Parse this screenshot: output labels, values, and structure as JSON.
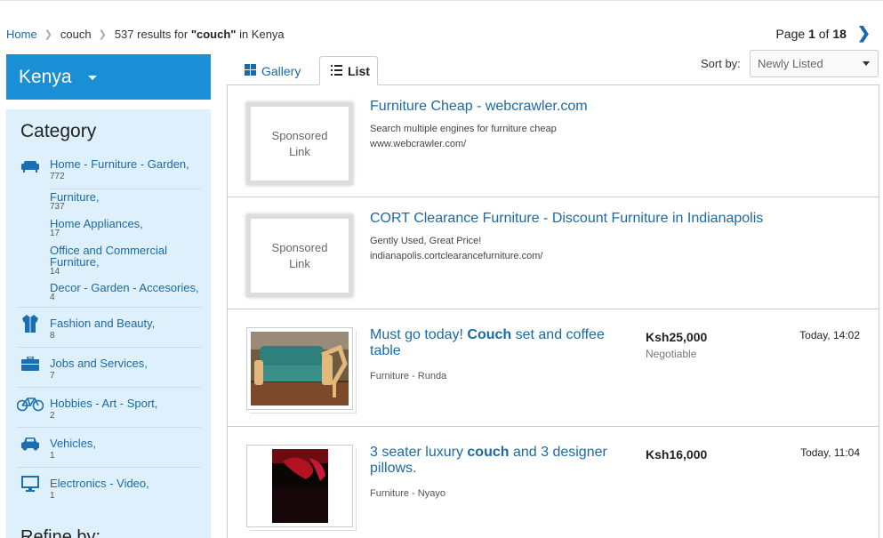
{
  "breadcrumb": {
    "home": "Home",
    "query": "couch",
    "results_prefix": "537 results for ",
    "results_query": "\"couch\"",
    "results_suffix": " in Kenya"
  },
  "pager": {
    "prefix": "Page ",
    "current": "1",
    "of": " of ",
    "total": "18"
  },
  "country": "Kenya",
  "sidebar": {
    "heading": "Category",
    "refine": "Refine by:",
    "categories": [
      {
        "label": "Home - Furniture - Garden,",
        "count": "772",
        "icon": "sofa-icon"
      },
      {
        "label": "Fashion and Beauty,",
        "count": "8",
        "icon": "jacket-icon"
      },
      {
        "label": "Jobs and Services,",
        "count": "7",
        "icon": "briefcase-icon"
      },
      {
        "label": "Hobbies - Art - Sport,",
        "count": "2",
        "icon": "bicycle-icon"
      },
      {
        "label": "Vehicles,",
        "count": "1",
        "icon": "car-icon"
      },
      {
        "label": "Electronics - Video,",
        "count": "1",
        "icon": "monitor-icon"
      }
    ],
    "subcategories": [
      {
        "label": "Furniture,",
        "count": "737"
      },
      {
        "label": "Home Appliances,",
        "count": "17"
      },
      {
        "label": "Office and Commercial",
        "label2": "Furniture,",
        "count": "14"
      },
      {
        "label": "Decor - Garden - Accesories,",
        "count": "4"
      }
    ]
  },
  "tabs": {
    "gallery": "Gallery",
    "list": "List"
  },
  "sort": {
    "label": "Sort by:",
    "selected": "Newly Listed"
  },
  "listings": [
    {
      "sponsored": true,
      "thumb_line1": "Sponsored",
      "thumb_line2": "Link",
      "title": "Furniture Cheap - webcrawler.com",
      "desc": "Search multiple engines for furniture cheap",
      "url": "www.webcrawler.com/"
    },
    {
      "sponsored": true,
      "thumb_line1": "Sponsored",
      "thumb_line2": "Link",
      "title": "CORT Clearance Furniture - Discount Furniture in Indianapolis",
      "desc": "Gently Used, Great Price!",
      "url": "indianapolis.cortclearancefurniture.com/"
    },
    {
      "sponsored": false,
      "title_pre": "Must go today! ",
      "title_bold": "Couch",
      "title_post": " set and coffee table",
      "location": "Furniture - Runda",
      "price": "Ksh25,000",
      "negotiable": "Negotiable",
      "date": "Today, 14:02"
    },
    {
      "sponsored": false,
      "title_pre": "3 seater luxury ",
      "title_bold": "couch",
      "title_post": " and 3 designer pillows.",
      "location": "Furniture - Nyayo",
      "price": "Ksh16,000",
      "date": "Today, 11:04"
    }
  ],
  "colors": {
    "accent": "#1b8fd6",
    "link": "#1a6aa8",
    "sidebar_bg": "#def0fb"
  }
}
